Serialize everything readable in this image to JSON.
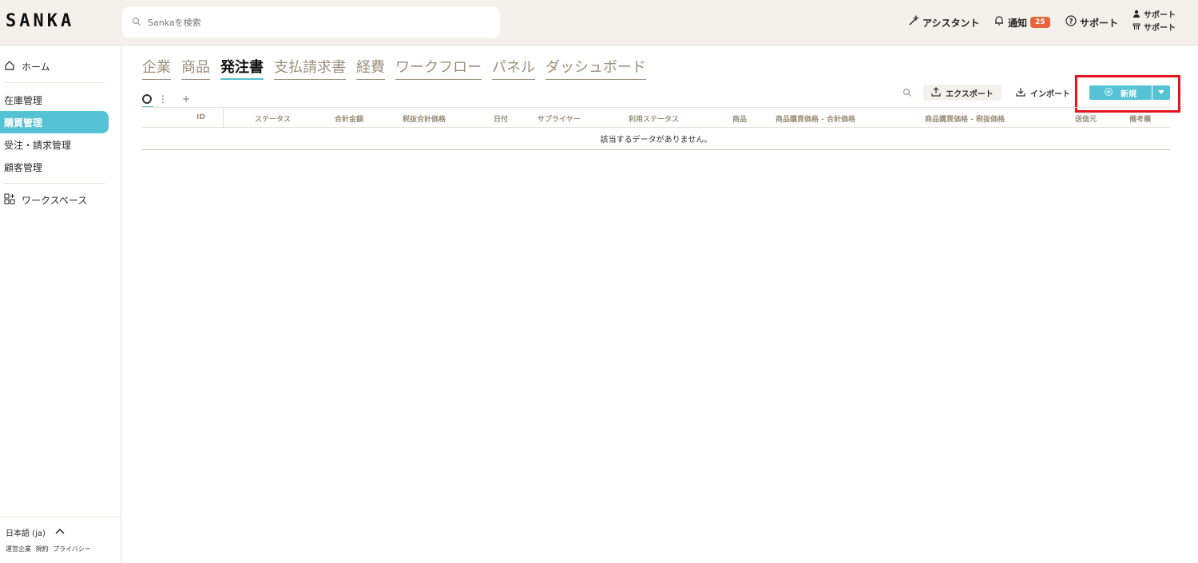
{
  "header": {
    "logo": "SANKA",
    "search_placeholder": "Sankaを検索",
    "assistant": "アシスタント",
    "notifications": "通知",
    "notification_count": "25",
    "support": "サポート",
    "user_line1": "サポート",
    "user_line2": "サポート"
  },
  "sidebar": {
    "home": "ホーム",
    "items": [
      {
        "label": "在庫管理"
      },
      {
        "label": "購買管理"
      },
      {
        "label": "受注・請求管理"
      },
      {
        "label": "顧客管理"
      }
    ],
    "workspace": "ワークスペース",
    "language": "日本語 (ja)",
    "footer_links": [
      "運営企業",
      "規約",
      "プライバシー"
    ]
  },
  "tabs": [
    "企業",
    "商品",
    "発注書",
    "支払請求書",
    "経費",
    "ワークフロー",
    "パネル",
    "ダッシュボード"
  ],
  "active_tab": "発注書",
  "toolbar": {
    "export": "エクスポート",
    "import": "インポート",
    "new": "新規"
  },
  "table": {
    "columns": [
      "ID",
      "ステータス",
      "合計金額",
      "税抜合計価格",
      "日付",
      "サプライヤー",
      "利用ステータス",
      "商品",
      "商品購買価格 - 合計価格",
      "商品購買価格 - 税抜価格",
      "送信元",
      "備考欄"
    ],
    "empty_message": "該当するデータがありません。"
  },
  "colors": {
    "accent": "#55c2d6",
    "badge": "#e8623c",
    "highlight": "#e6141e",
    "header_bg": "#f4f1ec"
  }
}
